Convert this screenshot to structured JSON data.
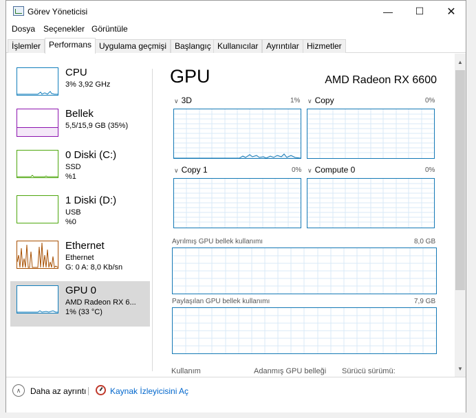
{
  "window": {
    "title": "Görev Yöneticisi"
  },
  "menu": {
    "items": [
      "Dosya",
      "Seçenekler",
      "Görüntüle"
    ]
  },
  "tabs": [
    "İşlemler",
    "Performans",
    "Uygulama geçmişi",
    "Başlangıç",
    "Kullanıcılar",
    "Ayrıntılar",
    "Hizmetler"
  ],
  "active_tab": "Performans",
  "sidebar": {
    "items": [
      {
        "title": "CPU",
        "line1": "3% 3,92 GHz",
        "line2": "",
        "color": "#117dbb"
      },
      {
        "title": "Bellek",
        "line1": "5,5/15,9 GB (35%)",
        "line2": "",
        "color": "#8b12ae"
      },
      {
        "title": "0 Diski (C:)",
        "line1": "SSD",
        "line2": "%1",
        "color": "#4da60c"
      },
      {
        "title": "1 Diski (D:)",
        "line1": "USB",
        "line2": "%0",
        "color": "#4da60c"
      },
      {
        "title": "Ethernet",
        "line1": "Ethernet",
        "line2_prefix": "G: 0 A: 8,0 Kb/sn",
        "color": "#a74f01"
      },
      {
        "title": "GPU 0",
        "line1": "AMD Radeon RX 6...",
        "line2": "1% (33 °C)",
        "color": "#117dbb"
      }
    ],
    "selected": "GPU 0"
  },
  "detail": {
    "title": "GPU",
    "model": "AMD Radeon RX 6600",
    "engines": [
      {
        "name": "3D",
        "percent": "1%"
      },
      {
        "name": "Copy",
        "percent": "0%"
      },
      {
        "name": "Copy 1",
        "percent": "0%"
      },
      {
        "name": "Compute 0",
        "percent": "0%"
      }
    ],
    "dedicated_memory": {
      "label": "Ayrılmış GPU bellek kullanımı",
      "value": "8,0 GB"
    },
    "shared_memory": {
      "label": "Paylaşılan GPU bellek kullanımı",
      "value": "7,9 GB"
    },
    "bottom_labels": [
      "Kullanım",
      "Adanmış GPU belleği",
      "Sürücü sürümü:"
    ]
  },
  "footer": {
    "fewer_details": "Daha az ayrıntı",
    "resource_monitor": "Kaynak İzleyicisini Aç"
  },
  "icons": [
    "task-manager-icon",
    "minimize-icon",
    "maximize-icon",
    "close-icon",
    "chevron-down-icon",
    "chevron-up-icon",
    "resource-monitor-icon"
  ],
  "accent_color": "#1378b5"
}
